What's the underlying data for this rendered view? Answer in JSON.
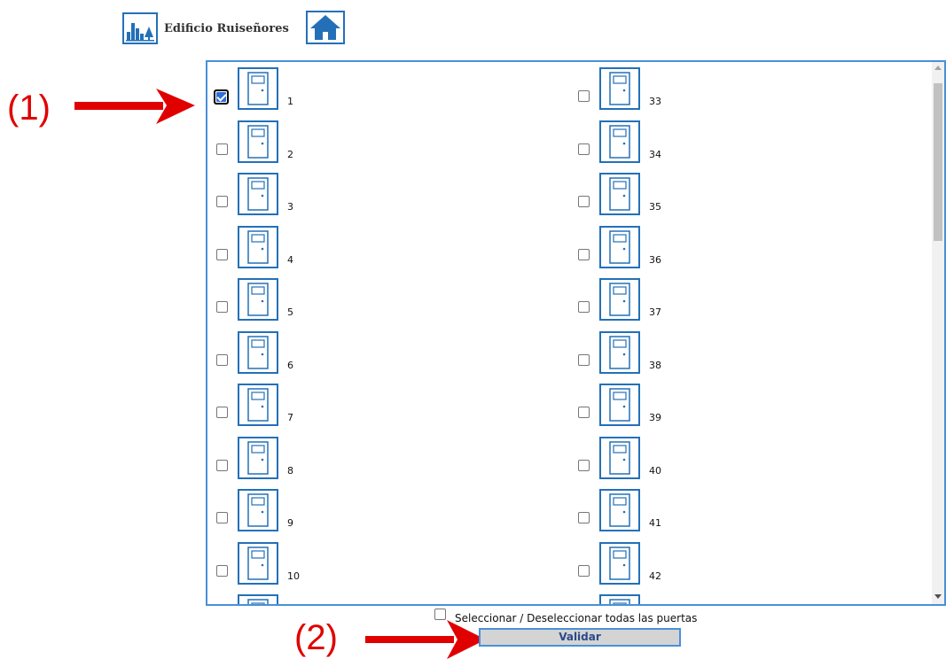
{
  "header": {
    "building_icon": "building-chart-icon",
    "title": "Edificio Ruiseñores",
    "home_icon": "home-icon"
  },
  "annotations": {
    "label_1": "(1)",
    "label_2": "(2)",
    "arrow_color": "#e00000"
  },
  "door_icon": "door-icon",
  "doors_left": [
    {
      "number": "1",
      "checked": true
    },
    {
      "number": "2",
      "checked": false
    },
    {
      "number": "3",
      "checked": false
    },
    {
      "number": "4",
      "checked": false
    },
    {
      "number": "5",
      "checked": false
    },
    {
      "number": "6",
      "checked": false
    },
    {
      "number": "7",
      "checked": false
    },
    {
      "number": "8",
      "checked": false
    },
    {
      "number": "9",
      "checked": false
    },
    {
      "number": "10",
      "checked": false
    }
  ],
  "doors_right": [
    {
      "number": "33",
      "checked": false
    },
    {
      "number": "34",
      "checked": false
    },
    {
      "number": "35",
      "checked": false
    },
    {
      "number": "36",
      "checked": false
    },
    {
      "number": "37",
      "checked": false
    },
    {
      "number": "38",
      "checked": false
    },
    {
      "number": "39",
      "checked": false
    },
    {
      "number": "40",
      "checked": false
    },
    {
      "number": "41",
      "checked": false
    },
    {
      "number": "42",
      "checked": false
    }
  ],
  "footer": {
    "select_all_label": "Seleccionar / Deseleccionar todas las puertas",
    "select_all_checked": false,
    "validate_label": "Validar"
  },
  "colors": {
    "accent": "#2470b8",
    "panel_border": "#4a90d9",
    "checkbox_checked": "#2f6fd6",
    "annotation": "#e00000"
  }
}
